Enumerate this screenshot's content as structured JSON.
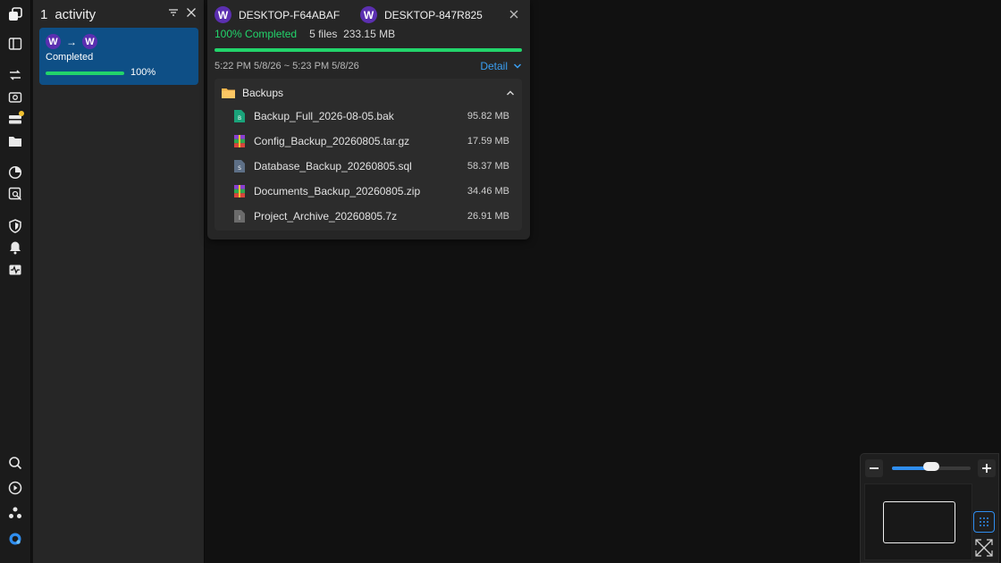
{
  "activity_panel": {
    "count": "1",
    "title": "activity",
    "card": {
      "source_initial": "W",
      "target_initial": "W",
      "arrow": "→",
      "status": "Completed",
      "progress_label": "100%",
      "progress": 1.0
    }
  },
  "transfer": {
    "source_device": {
      "initial": "W",
      "name": "DESKTOP-F64ABAF"
    },
    "target_device": {
      "initial": "W",
      "name": "DESKTOP-847R825"
    },
    "status": "100% Completed",
    "summary": "5 files  233.15 MB",
    "progress": 1.0,
    "time_range": "5:22 PM 5/8/26 ~ 5:23 PM 5/8/26",
    "detail_label": "Detail",
    "folder": {
      "name": "Backups",
      "files": [
        {
          "name": "Backup_Full_2026-08-05.bak",
          "size": "95.82 MB",
          "icon": "db-file-icon"
        },
        {
          "name": "Config_Backup_20260805.tar.gz",
          "size": "17.59 MB",
          "icon": "archive-file-icon"
        },
        {
          "name": "Database_Backup_20260805.sql",
          "size": "58.37 MB",
          "icon": "sql-file-icon"
        },
        {
          "name": "Documents_Backup_20260805.zip",
          "size": "34.46 MB",
          "icon": "archive-file-icon"
        },
        {
          "name": "Project_Archive_20260805.7z",
          "size": "26.91 MB",
          "icon": "generic-file-icon"
        }
      ]
    }
  },
  "zoom_control": {
    "level": 0.5
  },
  "colors": {
    "accent_blue": "#2f8ef0",
    "success_green": "#22d46b",
    "card_blue": "#0e4f86",
    "device_purple": "#5b2fb0",
    "notification_yellow": "#f2c230"
  }
}
